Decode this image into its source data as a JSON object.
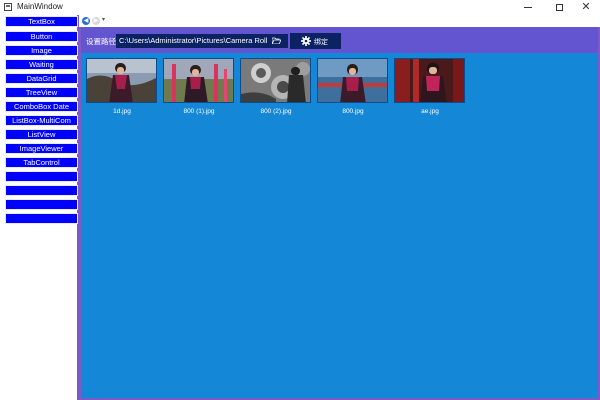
{
  "window": {
    "title": "MainWindow",
    "icons": {
      "app": "app-icon",
      "minimize": "minimize-icon",
      "maximize": "maximize-icon",
      "close": "close-icon"
    }
  },
  "sidebar": {
    "items": [
      {
        "label": "TextBox"
      },
      {
        "label": "Button"
      },
      {
        "label": "Image"
      },
      {
        "label": "Waiting"
      },
      {
        "label": "DataGrid"
      },
      {
        "label": "TreeView"
      },
      {
        "label": "ComboBox Date"
      },
      {
        "label": "ListBox-MultiCom"
      },
      {
        "label": "ListView"
      },
      {
        "label": "ImageViewer"
      },
      {
        "label": "TabControl"
      },
      {
        "label": ""
      },
      {
        "label": ""
      },
      {
        "label": ""
      },
      {
        "label": ""
      }
    ]
  },
  "nav": {
    "back_icon": "back-arrow-icon",
    "forward_icon": "forward-arrow-icon",
    "dropdown_icon": "chevron-down-icon"
  },
  "toolbar": {
    "path_label": "设置路径",
    "path_value": "C:\\Users\\Administrator\\Pictures\\Camera Roll",
    "browse_icon": "folder-open-icon",
    "bind_button_label": "绑定",
    "bind_icon": "gear-icon"
  },
  "images": [
    {
      "filename": "1d.jpg"
    },
    {
      "filename": "800 (1).jpg"
    },
    {
      "filename": "800 (2).jpg"
    },
    {
      "filename": "800.jpg"
    },
    {
      "filename": "ae.jpg"
    }
  ],
  "colors": {
    "sidebar_button": "#0000fe",
    "toolbar": "#6355cf",
    "content": "#1487d7",
    "input": "#0b2363",
    "border": "#7e5ac6"
  }
}
